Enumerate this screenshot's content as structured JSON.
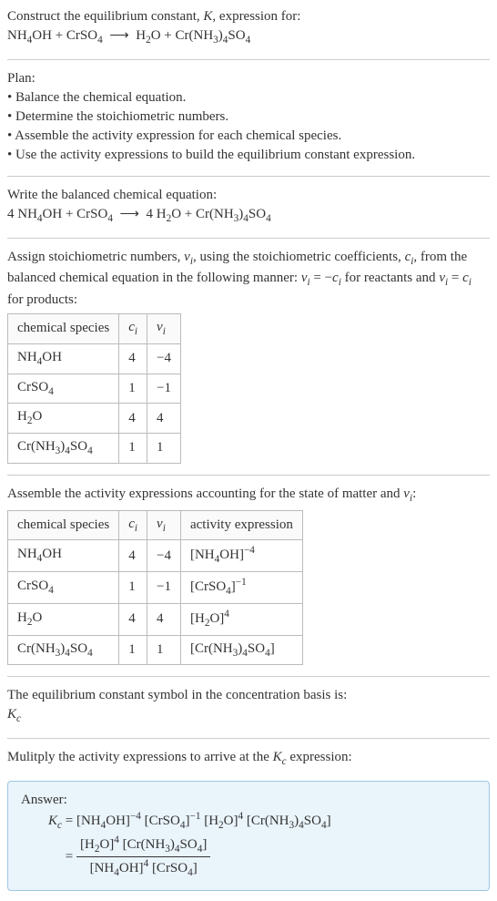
{
  "header": {
    "line1": "Construct the equilibrium constant, K, expression for:",
    "equation": "NH₄OH + CrSO₄ ⟶ H₂O + Cr(NH₃)₄SO₄"
  },
  "plan": {
    "title": "Plan:",
    "items": [
      "• Balance the chemical equation.",
      "• Determine the stoichiometric numbers.",
      "• Assemble the activity expression for each chemical species.",
      "• Use the activity expressions to build the equilibrium constant expression."
    ]
  },
  "balanced": {
    "title": "Write the balanced chemical equation:",
    "equation": "4 NH₄OH + CrSO₄ ⟶ 4 H₂O + Cr(NH₃)₄SO₄"
  },
  "stoich": {
    "text": "Assign stoichiometric numbers, νᵢ, using the stoichiometric coefficients, cᵢ, from the balanced chemical equation in the following manner: νᵢ = −cᵢ for reactants and νᵢ = cᵢ for products:",
    "headers": [
      "chemical species",
      "cᵢ",
      "νᵢ"
    ],
    "rows": [
      [
        "NH₄OH",
        "4",
        "−4"
      ],
      [
        "CrSO₄",
        "1",
        "−1"
      ],
      [
        "H₂O",
        "4",
        "4"
      ],
      [
        "Cr(NH₃)₄SO₄",
        "1",
        "1"
      ]
    ]
  },
  "activity": {
    "title": "Assemble the activity expressions accounting for the state of matter and νᵢ:",
    "headers": [
      "chemical species",
      "cᵢ",
      "νᵢ",
      "activity expression"
    ],
    "rows": [
      [
        "NH₄OH",
        "4",
        "−4",
        "[NH₄OH]⁻⁴"
      ],
      [
        "CrSO₄",
        "1",
        "−1",
        "[CrSO₄]⁻¹"
      ],
      [
        "H₂O",
        "4",
        "4",
        "[H₂O]⁴"
      ],
      [
        "Cr(NH₃)₄SO₄",
        "1",
        "1",
        "[Cr(NH₃)₄SO₄]"
      ]
    ]
  },
  "symbol": {
    "line1": "The equilibrium constant symbol in the concentration basis is:",
    "line2": "K_c"
  },
  "multiply": {
    "title": "Mulitply the activity expressions to arrive at the K_c expression:"
  },
  "answer": {
    "label": "Answer:",
    "line1": "K_c = [NH₄OH]⁻⁴ [CrSO₄]⁻¹ [H₂O]⁴ [Cr(NH₃)₄SO₄]",
    "frac_num": "[H₂O]⁴ [Cr(NH₃)₄SO₄]",
    "frac_den": "[NH₄OH]⁴ [CrSO₄]"
  }
}
